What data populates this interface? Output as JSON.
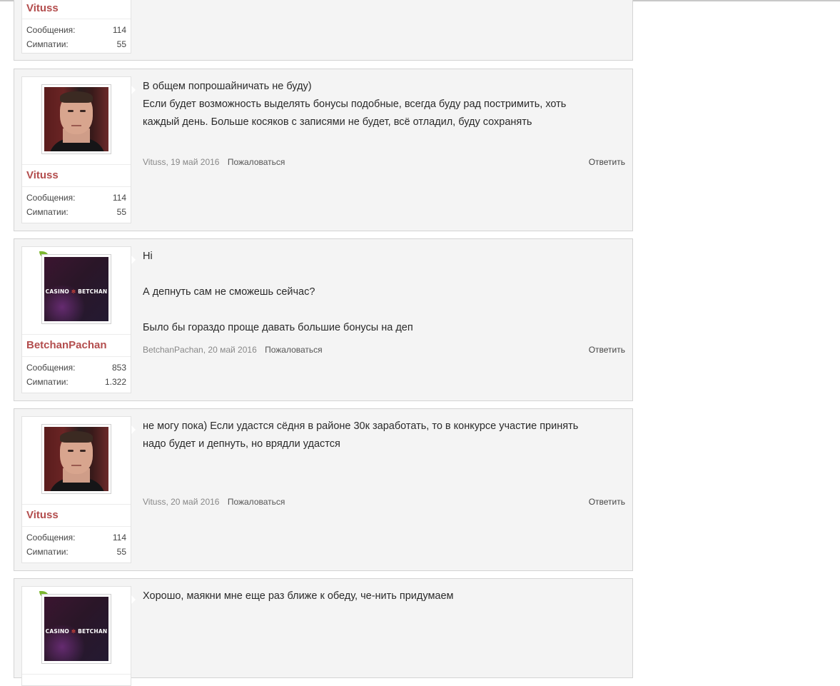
{
  "stat_labels": {
    "messages": "Сообщения:",
    "likes": "Симпатии:"
  },
  "actions": {
    "report": "Пожаловаться",
    "reply": "Ответить"
  },
  "logo_text": {
    "left": "CASINO",
    "star": "✻",
    "right": "BETCHAN"
  },
  "posts": [
    {
      "user": "Vituss",
      "messages": "114",
      "likes": "55"
    },
    {
      "user": "Vituss",
      "messages": "114",
      "likes": "55",
      "lines": [
        "В общем попрошайничать не буду)",
        "Если будет возможность выделять бонусы подобные, всегда буду рад постримить, хоть",
        "каждый день. Больше косяков с записями не будет, всё отладил, буду сохранять"
      ],
      "meta": "Vituss, 19 май 2016"
    },
    {
      "user": "BetchanPachan",
      "messages": "853",
      "likes": "1.322",
      "lines": [
        "Hi",
        "",
        "А депнуть сам не сможешь сейчас?",
        "",
        "Было бы гораздо проще давать большие бонусы на деп"
      ],
      "meta": "BetchanPachan, 20 май 2016"
    },
    {
      "user": "Vituss",
      "messages": "114",
      "likes": "55",
      "lines": [
        "не могу пока) Если удастся сёдня в районе 30к заработать, то в конкурсе участие принять",
        "надо будет и депнуть, но врядли удастся"
      ],
      "meta": "Vituss, 20 май 2016"
    },
    {
      "lines": [
        "Хорошо, маякни мне еще раз ближе к обеду, че-нить придумаем"
      ]
    }
  ]
}
